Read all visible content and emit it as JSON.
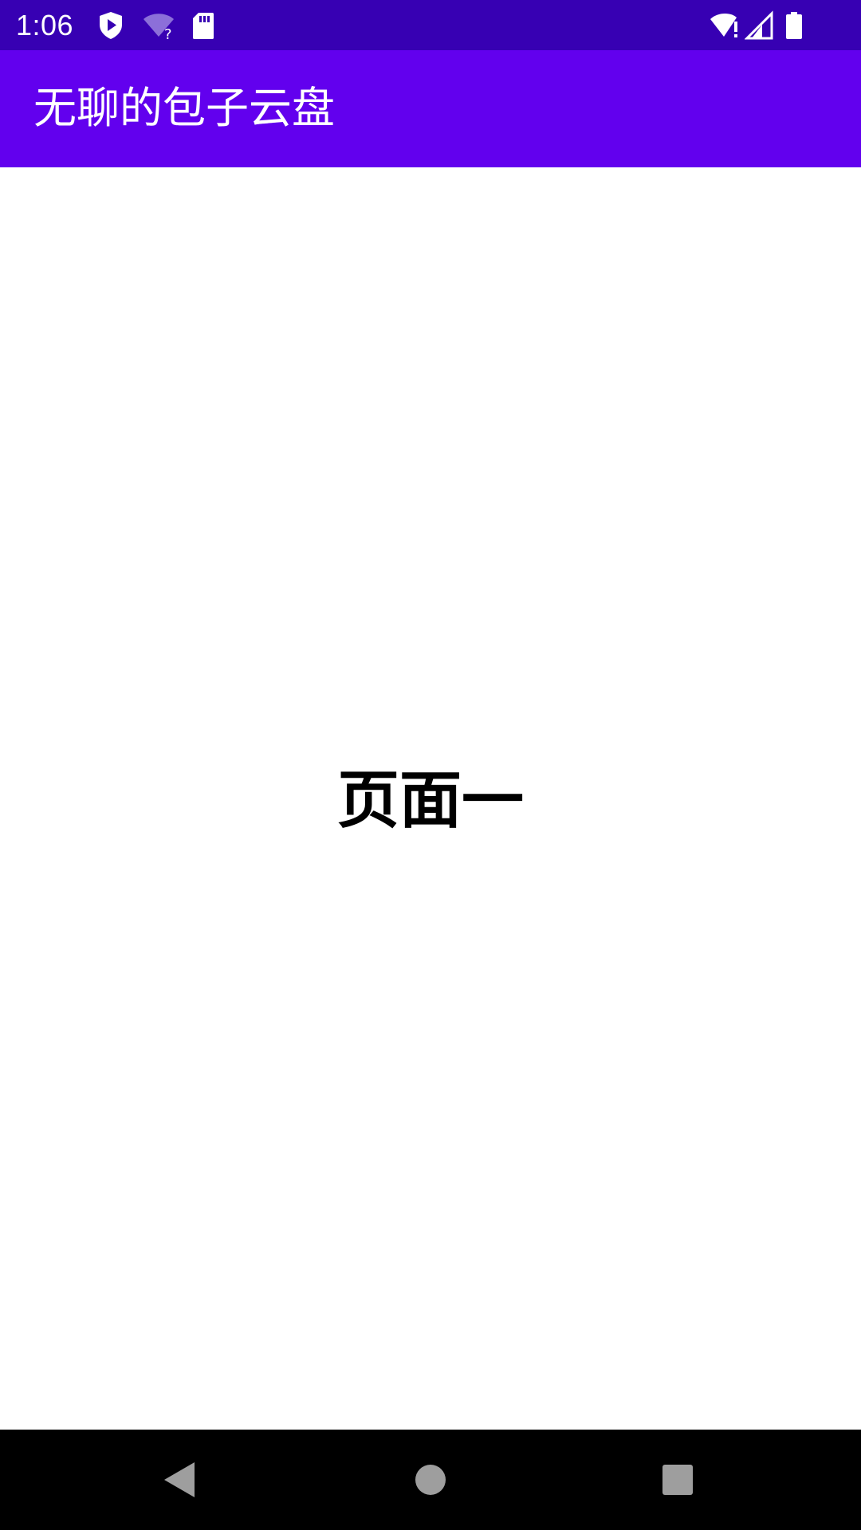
{
  "status_bar": {
    "time": "1:06",
    "icons": [
      "play-protect-icon",
      "wifi-unknown-icon",
      "sd-card-icon",
      "wifi-alert-icon",
      "cell-signal-icon",
      "battery-icon"
    ],
    "background": "#3700B3"
  },
  "app_bar": {
    "title": "无聊的包子云盘",
    "background": "#6200EE",
    "text_color": "#FFFFFF"
  },
  "content": {
    "label": "页面一"
  },
  "nav_bar": {
    "buttons": [
      "back-icon",
      "home-icon",
      "recents-icon"
    ],
    "button_color": "#9E9E9E"
  }
}
